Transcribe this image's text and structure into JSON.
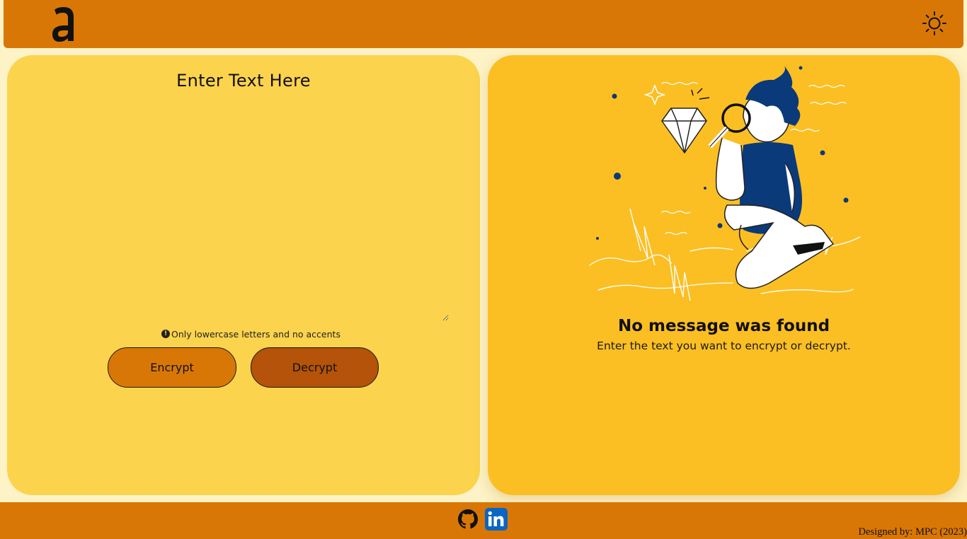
{
  "header": {
    "logo_icon": "letter-a-logo",
    "theme_toggle_icon": "sun-icon"
  },
  "input_panel": {
    "title": "Enter Text Here",
    "textarea_value": "",
    "hint_icon": "exclamation-circle-icon",
    "hint_text": "Only lowercase letters and no accents",
    "encrypt_label": "Encrypt",
    "decrypt_label": "Decrypt"
  },
  "output_panel": {
    "illustration": "person-with-magnifier-looking-at-diamond",
    "title": "No message was found",
    "subtitle": "Enter the text you want to encrypt or decrypt."
  },
  "footer": {
    "github_icon": "github-icon",
    "linkedin_icon": "linkedin-icon",
    "credits": "Designed by: MPC (2023)"
  },
  "colors": {
    "header_footer": "#d97706",
    "page_bg": "#fdf3c6",
    "left_panel": "#fcd34d",
    "right_panel": "#fbbf24",
    "encrypt_btn": "#d97706",
    "decrypt_btn": "#b45309",
    "illustration_accent": "#0b3a7a"
  }
}
